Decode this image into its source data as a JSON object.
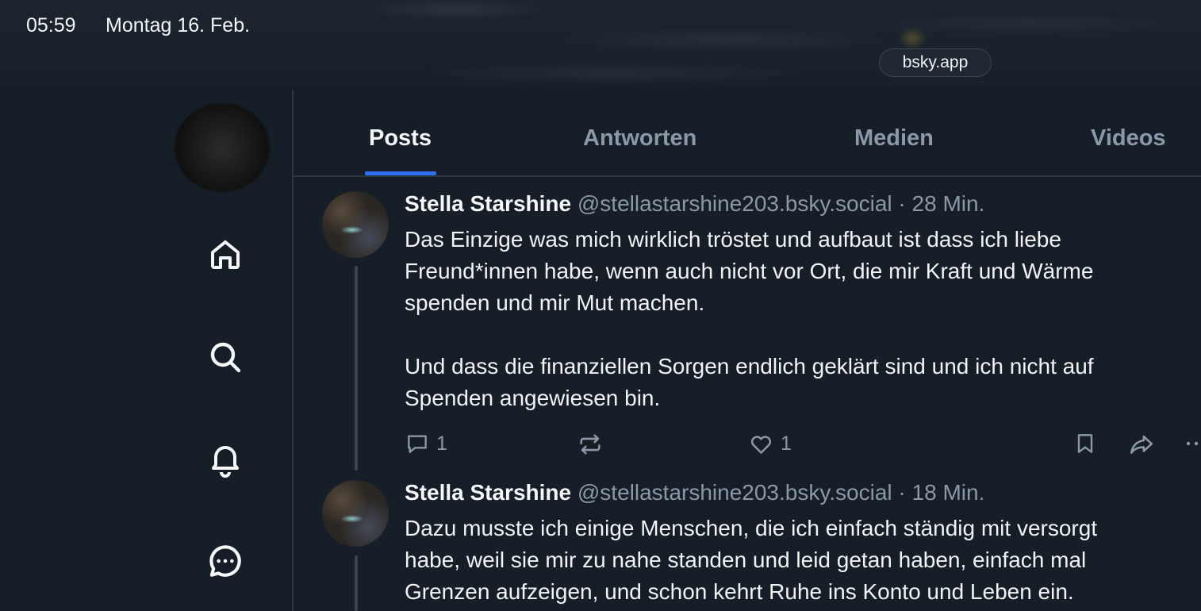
{
  "status_bar": {
    "time": "05:59",
    "date": "Montag 16. Feb.",
    "url": "bsky.app"
  },
  "sidebar": {
    "nav_items": [
      {
        "icon": "home-icon"
      },
      {
        "icon": "search-icon"
      },
      {
        "icon": "bell-icon"
      },
      {
        "icon": "chat-icon"
      }
    ]
  },
  "tabs": [
    {
      "label": "Posts",
      "active": true
    },
    {
      "label": "Antworten",
      "active": false
    },
    {
      "label": "Medien",
      "active": false
    },
    {
      "label": "Videos",
      "active": false
    }
  ],
  "posts": [
    {
      "author": "Stella Starshine",
      "handle": "@stellastarshine203.bsky.social",
      "separator": "·",
      "time": "28 Min.",
      "text": "Das Einzige was mich wirklich tröstet und aufbaut ist dass ich liebe\nFreund*innen habe, wenn auch nicht vor Ort, die mir Kraft und Wärme\nspenden und mir Mut machen.\n\nUnd dass die finanziellen Sorgen endlich geklärt sind und ich nicht auf\nSpenden angewiesen bin.",
      "replies": "1",
      "likes": "1"
    },
    {
      "author": "Stella Starshine",
      "handle": "@stellastarshine203.bsky.social",
      "separator": "·",
      "time": "18 Min.",
      "text": "Dazu musste ich einige Menschen, die ich einfach ständig mit versorgt\nhabe, weil sie mir zu nahe standen und leid getan haben, einfach mal\nGrenzen aufzeigen, und schon kehrt Ruhe ins Konto und Leben ein."
    }
  ],
  "colors": {
    "background": "#161e27",
    "accent": "#2f6ef5",
    "muted_text": "#8c98a8"
  }
}
